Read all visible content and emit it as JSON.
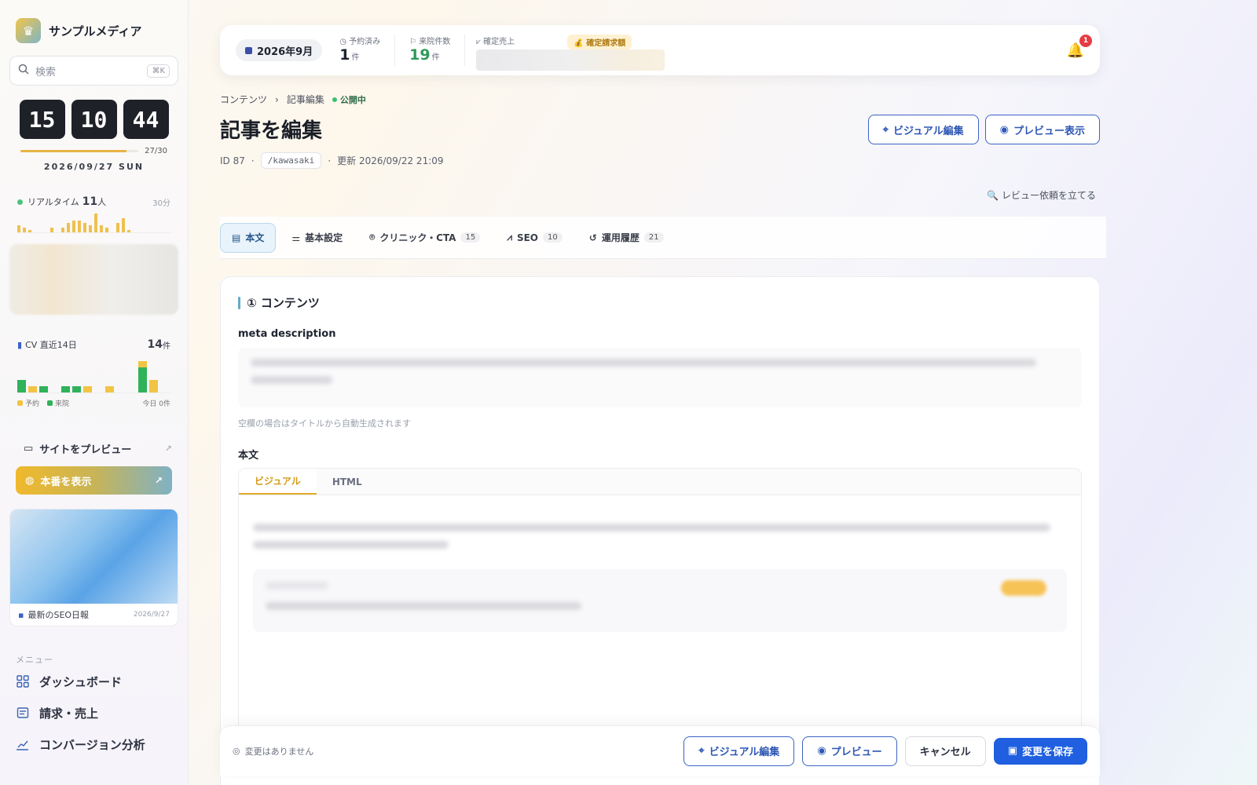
{
  "app": {
    "brand_name": "サンプルメディア",
    "brand_icon": "crown-icon"
  },
  "sidebar": {
    "search_placeholder": "検索",
    "search_shortcut": "⌘K",
    "clock": {
      "hours": "15",
      "minutes": "10",
      "seconds": "44"
    },
    "month_progress": {
      "label": "27/30",
      "fraction": 0.9
    },
    "date": "2026/09/27 SUN",
    "realtime": {
      "label": "リアルタイム",
      "count": "11",
      "unit": "人",
      "window": "30分",
      "bars": [
        6,
        4,
        2,
        0,
        0,
        0,
        4,
        0,
        4,
        8,
        10,
        10,
        8,
        6,
        16,
        6,
        4,
        0,
        8,
        12,
        2
      ]
    },
    "cv": {
      "label": "CV 直近14日",
      "total": "14",
      "unit": "件",
      "legend_reserve": "予約",
      "legend_visit": "来院",
      "today_label": "今日 0件",
      "days": [
        {
          "visit": 2,
          "reserve": 0
        },
        {
          "visit": 0,
          "reserve": 1
        },
        {
          "visit": 1,
          "reserve": 0
        },
        {
          "visit": 0,
          "reserve": 0
        },
        {
          "visit": 1,
          "reserve": 0
        },
        {
          "visit": 1,
          "reserve": 0
        },
        {
          "visit": 0,
          "reserve": 1
        },
        {
          "visit": 0,
          "reserve": 0
        },
        {
          "visit": 0,
          "reserve": 1
        },
        {
          "visit": 0,
          "reserve": 0
        },
        {
          "visit": 0,
          "reserve": 0
        },
        {
          "visit": 4,
          "reserve": 1
        },
        {
          "visit": 0,
          "reserve": 2
        },
        {
          "visit": 0,
          "reserve": 0
        }
      ]
    },
    "site_preview_label": "サイトをプレビュー",
    "production_label": "本番を表示",
    "news": {
      "label": "最新のSEO日報",
      "date": "2026/9/27"
    },
    "menu_label": "メニュー",
    "menu": [
      {
        "label": "ダッシュボード",
        "icon": "grid-icon"
      },
      {
        "label": "請求・売上",
        "icon": "invoice-icon"
      },
      {
        "label": "コンバージョン分析",
        "icon": "chart-icon"
      }
    ]
  },
  "topbar": {
    "month": "2026年9月",
    "kpis": [
      {
        "label": "予約済み",
        "value": "1",
        "unit": "件"
      },
      {
        "label": "来院件数",
        "value": "19",
        "unit": "件"
      }
    ],
    "sales_label": "確定売上",
    "billing_label": "確定請求額",
    "notifications": "1"
  },
  "breadcrumb": {
    "root": "コンテンツ",
    "current": "記事編集",
    "status": "公開中"
  },
  "page": {
    "title": "記事を編集",
    "id": "ID 87",
    "slug": "/kawasaki",
    "updated": "更新 2026/09/22 21:09",
    "visual_edit_label": "ビジュアル編集",
    "preview_label": "プレビュー表示",
    "review_link": "レビュー依頼を立てる"
  },
  "tabs": [
    {
      "label": "本文",
      "count": "",
      "icon": "document-icon",
      "active": true
    },
    {
      "label": "基本設定",
      "count": "",
      "icon": "sliders-icon",
      "active": false
    },
    {
      "label": "クリニック・CTA",
      "count": "15",
      "icon": "pin-icon",
      "active": false
    },
    {
      "label": "SEO",
      "count": "10",
      "icon": "trend-icon",
      "active": false
    },
    {
      "label": "運用履歴",
      "count": "21",
      "icon": "history-icon",
      "active": false
    }
  ],
  "content": {
    "section_title": "① コンテンツ",
    "meta_label": "meta description",
    "meta_hint": "空欄の場合はタイトルから自動生成されます",
    "body_label": "本文",
    "editor_tabs": [
      "ビジュアル",
      "HTML"
    ]
  },
  "save_bar": {
    "status": "変更はありません",
    "visual_edit": "ビジュアル編集",
    "preview": "プレビュー",
    "cancel": "キャンセル",
    "save": "変更を保存"
  }
}
